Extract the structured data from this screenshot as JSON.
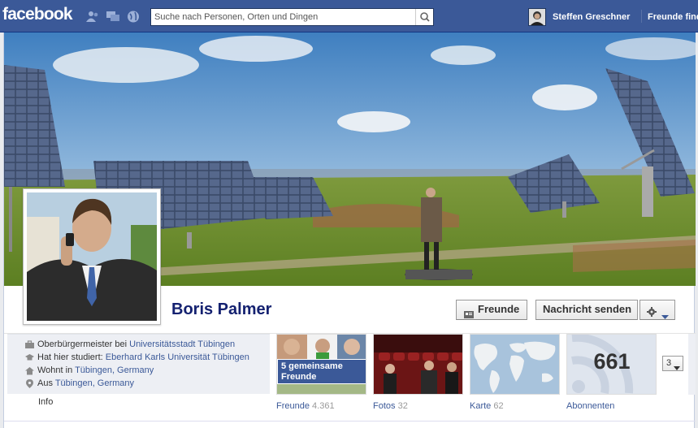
{
  "topbar": {
    "logo": "facebook",
    "search_placeholder": "Suche nach Personen, Orten und Dingen",
    "user_name": "Steffen Greschner",
    "friends_link": "Freunde finden"
  },
  "profile": {
    "name": "Boris Palmer",
    "friend_button": "Freunde",
    "message_button": "Nachricht senden"
  },
  "info": {
    "job_prefix": "Oberbürgermeister bei",
    "job_link": "Universitätsstadt Tübingen",
    "study_prefix": "Hat hier studiert:",
    "study_link": "Eberhard Karls Universität Tübingen",
    "lives_prefix": "Wohnt in",
    "lives_link": "Tübingen, Germany",
    "from_prefix": "Aus",
    "from_link": "Tübingen, Germany",
    "info_link": "Info"
  },
  "tiles": {
    "friends_badge": "5 gemeinsame Freunde",
    "friends_label": "Freunde",
    "friends_count": "4.361",
    "photos_label": "Fotos",
    "photos_count": "32",
    "map_label": "Karte",
    "map_count": "62",
    "subscribers_number": "661",
    "subscribers_label": "Abonnenten",
    "more_count": "3"
  },
  "colors": {
    "brand": "#3b5998",
    "link": "#3b5998",
    "name": "#142170"
  }
}
